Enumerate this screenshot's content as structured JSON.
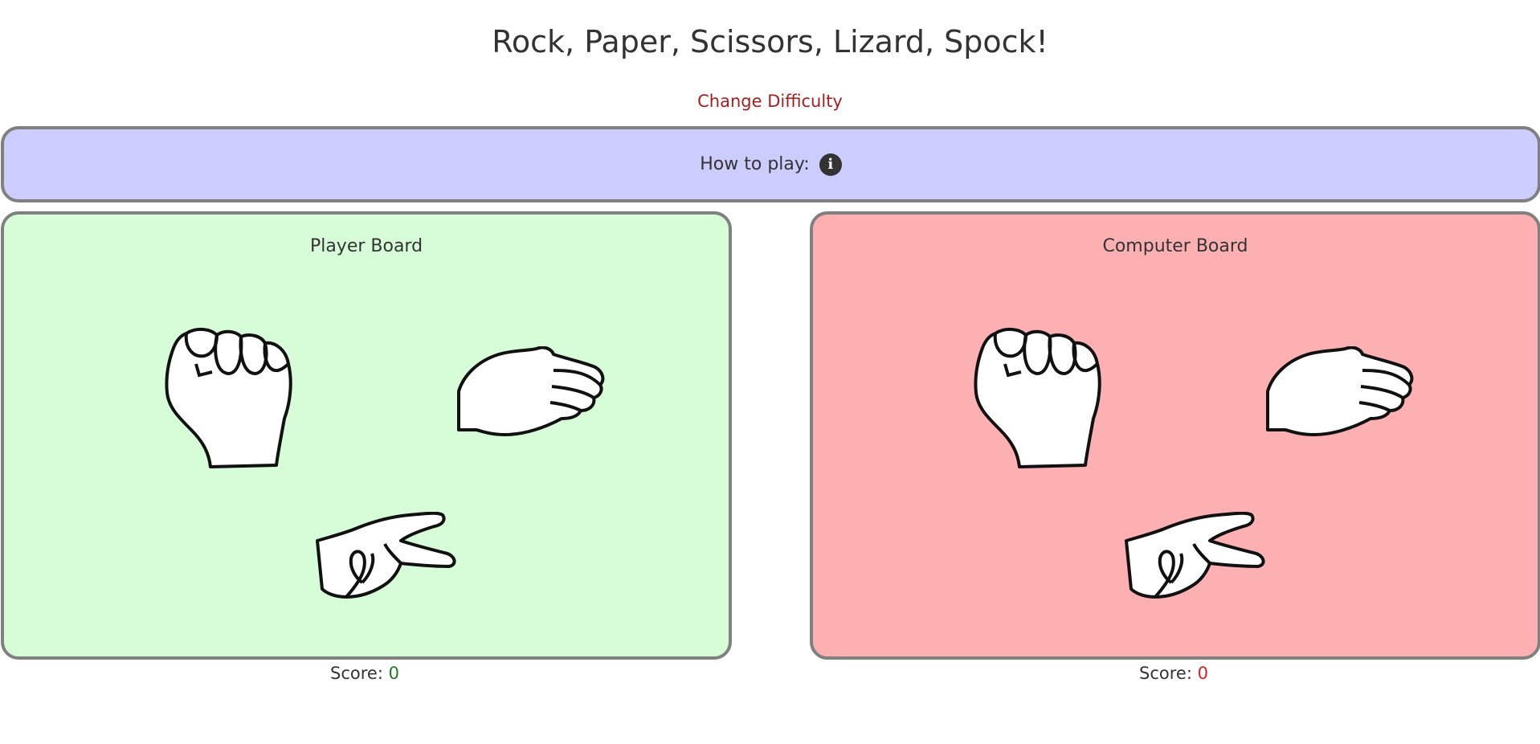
{
  "header": {
    "title": "Rock, Paper, Scissors, Lizard, Spock!",
    "change_difficulty": "Change Difficulty"
  },
  "how_to_play": {
    "label": "How to play:",
    "icon": "info-circle-icon"
  },
  "boards": {
    "player": {
      "title": "Player Board",
      "background": "#d6fdd8",
      "hands": [
        "rock-hand-icon",
        "paper-hand-icon",
        "scissors-hand-icon"
      ]
    },
    "computer": {
      "title": "Computer Board",
      "background": "#fdb0b2",
      "hands": [
        "rock-hand-icon",
        "paper-hand-icon",
        "scissors-hand-icon"
      ]
    }
  },
  "scores": {
    "label": "Score:",
    "player": "0",
    "computer": "0",
    "player_color": "#1e7a1e",
    "computer_color": "#e02020"
  },
  "colors": {
    "how_to_play_bg": "#ccccff",
    "link": "#a32020",
    "border": "#808080"
  }
}
